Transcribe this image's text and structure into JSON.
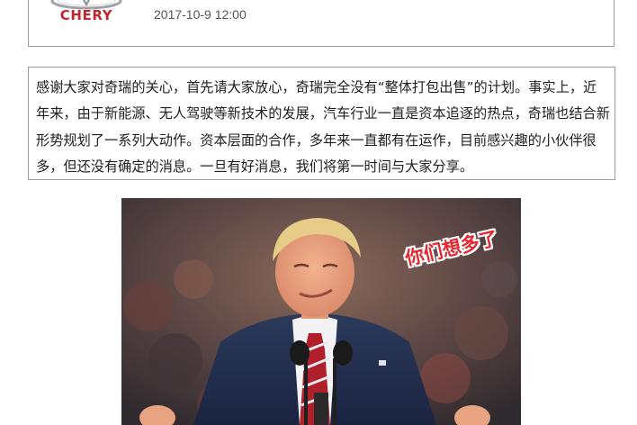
{
  "post": {
    "brand": "CHERY",
    "logo_icon": "chery-logo-icon",
    "date": "2017-10-9 12:00"
  },
  "message": {
    "text": "感谢大家对奇瑞的关心，首先请大家放心，奇瑞完全没有“整体打包出售”的计划。事实上，近年来，由于新能源、无人驾驶等新技术的发展，汽车行业一直是资本追逐的热点，奇瑞也结合新形势规划了一系列大动作。资本层面的合作，多年来一直都有在运作，目前感兴趣的小伙伴很多，但还没有确定的消息。一旦有好消息，我们将第一时间与大家分享。"
  },
  "meme": {
    "caption": "你们想多了"
  },
  "colors": {
    "brand_red": "#c0262c",
    "caption_red": "#e4272f",
    "border": "#9a9a9a",
    "date_text": "#555555"
  }
}
